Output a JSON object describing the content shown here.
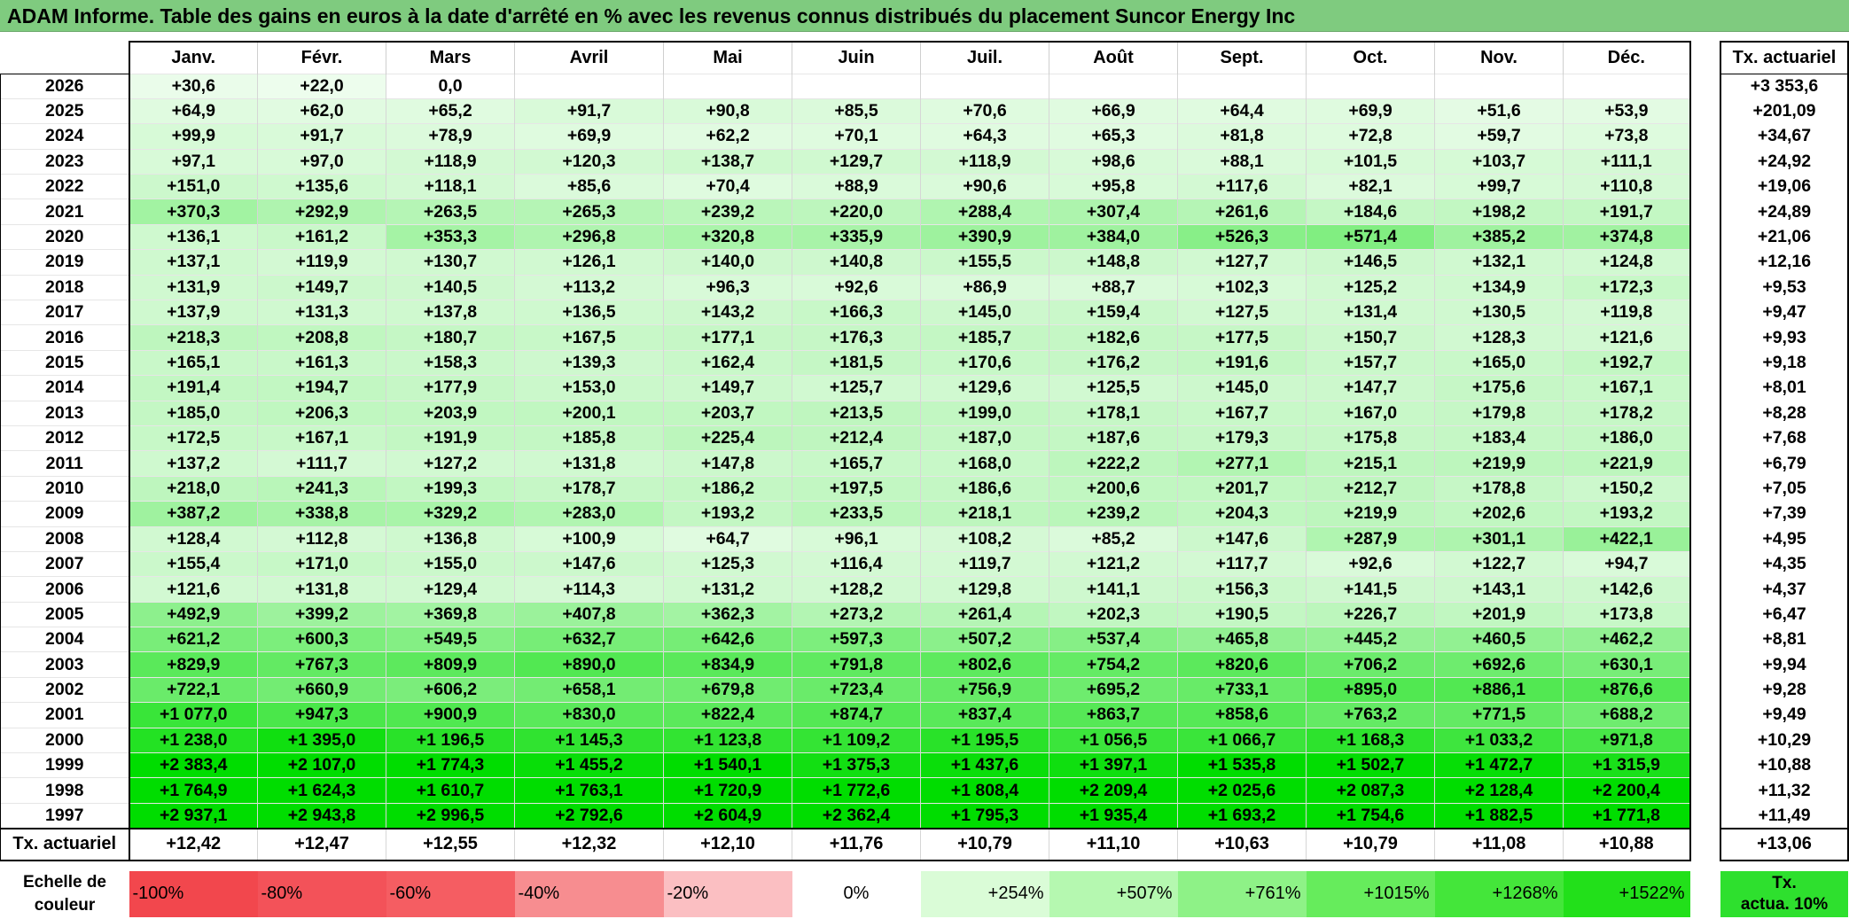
{
  "title": "ADAM Informe. Table des gains en euros à la date d'arrêté en % avec les revenus connus distribués du placement Suncor Energy Inc",
  "months": [
    "Janv.",
    "Févr.",
    "Mars",
    "Avril",
    "Mai",
    "Juin",
    "Juil.",
    "Août",
    "Sept.",
    "Oct.",
    "Nov.",
    "Déc."
  ],
  "annual_header": "Tx. actuariel",
  "rows": [
    {
      "year": "2026",
      "cells": [
        "+30,6",
        "+22,0",
        "0,0",
        "",
        "",
        "",
        "",
        "",
        "",
        "",
        "",
        ""
      ],
      "annual": "+3 353,6"
    },
    {
      "year": "2025",
      "cells": [
        "+64,9",
        "+62,0",
        "+65,2",
        "+91,7",
        "+90,8",
        "+85,5",
        "+70,6",
        "+66,9",
        "+64,4",
        "+69,9",
        "+51,6",
        "+53,9"
      ],
      "annual": "+201,09"
    },
    {
      "year": "2024",
      "cells": [
        "+99,9",
        "+91,7",
        "+78,9",
        "+69,9",
        "+62,2",
        "+70,1",
        "+64,3",
        "+65,3",
        "+81,8",
        "+72,8",
        "+59,7",
        "+73,8"
      ],
      "annual": "+34,67"
    },
    {
      "year": "2023",
      "cells": [
        "+97,1",
        "+97,0",
        "+118,9",
        "+120,3",
        "+138,7",
        "+129,7",
        "+118,9",
        "+98,6",
        "+88,1",
        "+101,5",
        "+103,7",
        "+111,1"
      ],
      "annual": "+24,92"
    },
    {
      "year": "2022",
      "cells": [
        "+151,0",
        "+135,6",
        "+118,1",
        "+85,6",
        "+70,4",
        "+88,9",
        "+90,6",
        "+95,8",
        "+117,6",
        "+82,1",
        "+99,7",
        "+110,8"
      ],
      "annual": "+19,06"
    },
    {
      "year": "2021",
      "cells": [
        "+370,3",
        "+292,9",
        "+263,5",
        "+265,3",
        "+239,2",
        "+220,0",
        "+288,4",
        "+307,4",
        "+261,6",
        "+184,6",
        "+198,2",
        "+191,7"
      ],
      "annual": "+24,89"
    },
    {
      "year": "2020",
      "cells": [
        "+136,1",
        "+161,2",
        "+353,3",
        "+296,8",
        "+320,8",
        "+335,9",
        "+390,9",
        "+384,0",
        "+526,3",
        "+571,4",
        "+385,2",
        "+374,8"
      ],
      "annual": "+21,06"
    },
    {
      "year": "2019",
      "cells": [
        "+137,1",
        "+119,9",
        "+130,7",
        "+126,1",
        "+140,0",
        "+140,8",
        "+155,5",
        "+148,8",
        "+127,7",
        "+146,5",
        "+132,1",
        "+124,8"
      ],
      "annual": "+12,16"
    },
    {
      "year": "2018",
      "cells": [
        "+131,9",
        "+149,7",
        "+140,5",
        "+113,2",
        "+96,3",
        "+92,6",
        "+86,9",
        "+88,7",
        "+102,3",
        "+125,2",
        "+134,9",
        "+172,3"
      ],
      "annual": "+9,53"
    },
    {
      "year": "2017",
      "cells": [
        "+137,9",
        "+131,3",
        "+137,8",
        "+136,5",
        "+143,2",
        "+166,3",
        "+145,0",
        "+159,4",
        "+127,5",
        "+131,4",
        "+130,5",
        "+119,8"
      ],
      "annual": "+9,47"
    },
    {
      "year": "2016",
      "cells": [
        "+218,3",
        "+208,8",
        "+180,7",
        "+167,5",
        "+177,1",
        "+176,3",
        "+185,7",
        "+182,6",
        "+177,5",
        "+150,7",
        "+128,3",
        "+121,6"
      ],
      "annual": "+9,93"
    },
    {
      "year": "2015",
      "cells": [
        "+165,1",
        "+161,3",
        "+158,3",
        "+139,3",
        "+162,4",
        "+181,5",
        "+170,6",
        "+176,2",
        "+191,6",
        "+157,7",
        "+165,0",
        "+192,7"
      ],
      "annual": "+9,18"
    },
    {
      "year": "2014",
      "cells": [
        "+191,4",
        "+194,7",
        "+177,9",
        "+153,0",
        "+149,7",
        "+125,7",
        "+129,6",
        "+125,5",
        "+145,0",
        "+147,7",
        "+175,6",
        "+167,1"
      ],
      "annual": "+8,01"
    },
    {
      "year": "2013",
      "cells": [
        "+185,0",
        "+206,3",
        "+203,9",
        "+200,1",
        "+203,7",
        "+213,5",
        "+199,0",
        "+178,1",
        "+167,7",
        "+167,0",
        "+179,8",
        "+178,2"
      ],
      "annual": "+8,28"
    },
    {
      "year": "2012",
      "cells": [
        "+172,5",
        "+167,1",
        "+191,9",
        "+185,8",
        "+225,4",
        "+212,4",
        "+187,0",
        "+187,6",
        "+179,3",
        "+175,8",
        "+183,4",
        "+186,0"
      ],
      "annual": "+7,68"
    },
    {
      "year": "2011",
      "cells": [
        "+137,2",
        "+111,7",
        "+127,2",
        "+131,8",
        "+147,8",
        "+165,7",
        "+168,0",
        "+222,2",
        "+277,1",
        "+215,1",
        "+219,9",
        "+221,9"
      ],
      "annual": "+6,79"
    },
    {
      "year": "2010",
      "cells": [
        "+218,0",
        "+241,3",
        "+199,3",
        "+178,7",
        "+186,2",
        "+197,5",
        "+186,6",
        "+200,6",
        "+201,7",
        "+212,7",
        "+178,8",
        "+150,2"
      ],
      "annual": "+7,05"
    },
    {
      "year": "2009",
      "cells": [
        "+387,2",
        "+338,8",
        "+329,2",
        "+283,0",
        "+193,2",
        "+233,5",
        "+218,1",
        "+239,2",
        "+204,3",
        "+219,9",
        "+202,6",
        "+193,2"
      ],
      "annual": "+7,39"
    },
    {
      "year": "2008",
      "cells": [
        "+128,4",
        "+112,8",
        "+136,8",
        "+100,9",
        "+64,7",
        "+96,1",
        "+108,2",
        "+85,2",
        "+147,6",
        "+287,9",
        "+301,1",
        "+422,1"
      ],
      "annual": "+4,95"
    },
    {
      "year": "2007",
      "cells": [
        "+155,4",
        "+171,0",
        "+155,0",
        "+147,6",
        "+125,3",
        "+116,4",
        "+119,7",
        "+121,2",
        "+117,7",
        "+92,6",
        "+122,7",
        "+94,7"
      ],
      "annual": "+4,35"
    },
    {
      "year": "2006",
      "cells": [
        "+121,6",
        "+131,8",
        "+129,4",
        "+114,3",
        "+131,2",
        "+128,2",
        "+129,8",
        "+141,1",
        "+156,3",
        "+141,5",
        "+143,1",
        "+142,6"
      ],
      "annual": "+4,37"
    },
    {
      "year": "2005",
      "cells": [
        "+492,9",
        "+399,2",
        "+369,8",
        "+407,8",
        "+362,3",
        "+273,2",
        "+261,4",
        "+202,3",
        "+190,5",
        "+226,7",
        "+201,9",
        "+173,8"
      ],
      "annual": "+6,47"
    },
    {
      "year": "2004",
      "cells": [
        "+621,2",
        "+600,3",
        "+549,5",
        "+632,7",
        "+642,6",
        "+597,3",
        "+507,2",
        "+537,4",
        "+465,8",
        "+445,2",
        "+460,5",
        "+462,2"
      ],
      "annual": "+8,81"
    },
    {
      "year": "2003",
      "cells": [
        "+829,9",
        "+767,3",
        "+809,9",
        "+890,0",
        "+834,9",
        "+791,8",
        "+802,6",
        "+754,2",
        "+820,6",
        "+706,2",
        "+692,6",
        "+630,1"
      ],
      "annual": "+9,94"
    },
    {
      "year": "2002",
      "cells": [
        "+722,1",
        "+660,9",
        "+606,2",
        "+658,1",
        "+679,8",
        "+723,4",
        "+756,9",
        "+695,2",
        "+733,1",
        "+895,0",
        "+886,1",
        "+876,6"
      ],
      "annual": "+9,28"
    },
    {
      "year": "2001",
      "cells": [
        "+1 077,0",
        "+947,3",
        "+900,9",
        "+830,0",
        "+822,4",
        "+874,7",
        "+837,4",
        "+863,7",
        "+858,6",
        "+763,2",
        "+771,5",
        "+688,2"
      ],
      "annual": "+9,49"
    },
    {
      "year": "2000",
      "cells": [
        "+1 238,0",
        "+1 395,0",
        "+1 196,5",
        "+1 145,3",
        "+1 123,8",
        "+1 109,2",
        "+1 195,5",
        "+1 056,5",
        "+1 066,7",
        "+1 168,3",
        "+1 033,2",
        "+971,8"
      ],
      "annual": "+10,29"
    },
    {
      "year": "1999",
      "cells": [
        "+2 383,4",
        "+2 107,0",
        "+1 774,3",
        "+1 455,2",
        "+1 540,1",
        "+1 375,3",
        "+1 437,6",
        "+1 397,1",
        "+1 535,8",
        "+1 502,7",
        "+1 472,7",
        "+1 315,9"
      ],
      "annual": "+10,88"
    },
    {
      "year": "1998",
      "cells": [
        "+1 764,9",
        "+1 624,3",
        "+1 610,7",
        "+1 763,1",
        "+1 720,9",
        "+1 772,6",
        "+1 808,4",
        "+2 209,4",
        "+2 025,6",
        "+2 087,3",
        "+2 128,4",
        "+2 200,4"
      ],
      "annual": "+11,32"
    },
    {
      "year": "1997",
      "cells": [
        "+2 937,1",
        "+2 943,8",
        "+2 996,5",
        "+2 792,6",
        "+2 604,9",
        "+2 362,4",
        "+1 795,3",
        "+1 935,4",
        "+1 693,2",
        "+1 754,6",
        "+1 882,5",
        "+1 771,8"
      ],
      "annual": "+11,49"
    }
  ],
  "actuarial_row": {
    "label": "Tx. actuariel",
    "cells": [
      "+12,42",
      "+12,47",
      "+12,55",
      "+12,32",
      "+12,10",
      "+11,76",
      "+10,79",
      "+11,10",
      "+10,63",
      "+10,79",
      "+11,08",
      "+10,88"
    ],
    "annual": "+13,06"
  },
  "scale": {
    "label_line1": "Echelle de",
    "label_line2": "couleur",
    "items": [
      {
        "text": "-100%",
        "color": "#f2474d"
      },
      {
        "text": "-80%",
        "color": "#f35259"
      },
      {
        "text": "-60%",
        "color": "#f55d62"
      },
      {
        "text": "-40%",
        "color": "#f78d90"
      },
      {
        "text": "-20%",
        "color": "#fbbfc2"
      },
      {
        "text": "0%",
        "color": "#ffffff"
      },
      {
        "text": "+254%",
        "color": "#dafcd7"
      },
      {
        "text": "+507%",
        "color": "#b5f8b0"
      },
      {
        "text": "+761%",
        "color": "#8ef287"
      },
      {
        "text": "+1015%",
        "color": "#66ec5c"
      },
      {
        "text": "+1268%",
        "color": "#44e63a"
      },
      {
        "text": "+1522%",
        "color": "#22e01a"
      }
    ],
    "annual_line1": "Tx.",
    "annual_line2": "actua. 10%"
  }
}
